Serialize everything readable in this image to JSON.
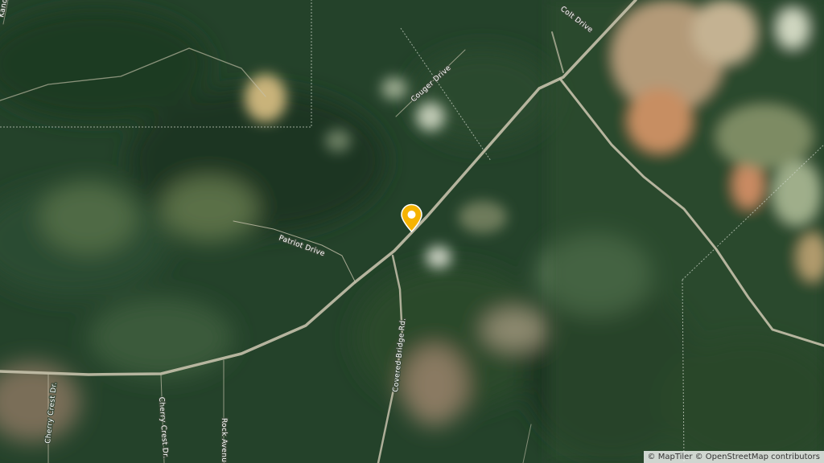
{
  "map": {
    "type": "satellite",
    "streets": [
      {
        "id": "colt",
        "label": "Colt Drive"
      },
      {
        "id": "couger",
        "label": "Couger Drive"
      },
      {
        "id": "patriot",
        "label": "Patriot Drive"
      },
      {
        "id": "covered-bridge",
        "label": "Covered Bridge Rd."
      },
      {
        "id": "cherry-crest-1",
        "label": "Cherry Crest Dr."
      },
      {
        "id": "cherry-crest-2",
        "label": "Cherry Crest Dr."
      },
      {
        "id": "rock-avenue",
        "label": "Rock Avenue"
      },
      {
        "id": "kano",
        "label": "Kano"
      }
    ],
    "marker": {
      "color": "#f5b301",
      "icon": "location-pin-icon"
    },
    "attribution": "© MapTiler © OpenStreetMap contributors"
  }
}
